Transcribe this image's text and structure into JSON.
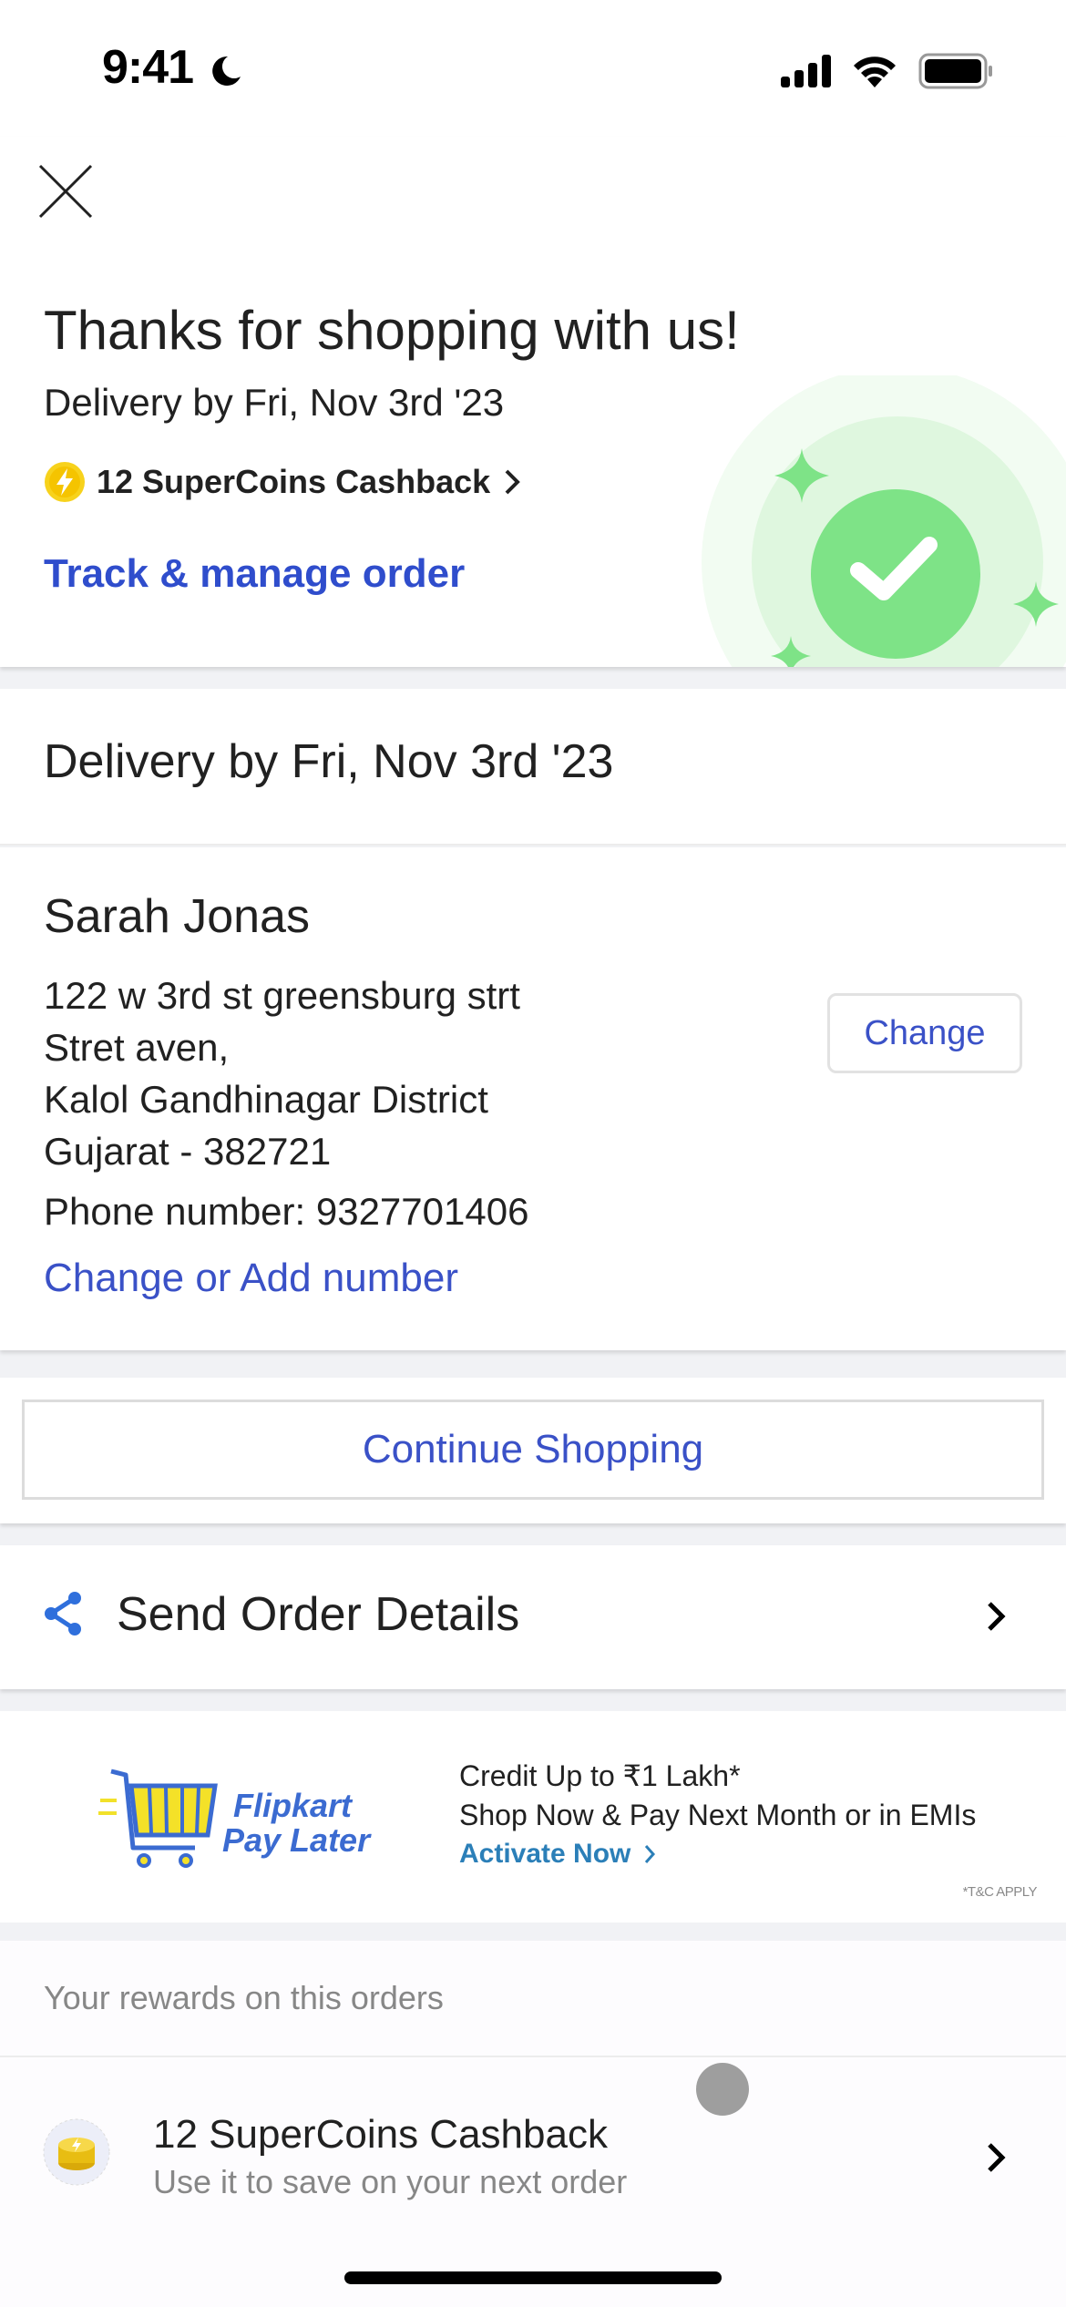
{
  "status_bar": {
    "time": "9:41",
    "focus_icon": "moon-icon",
    "signal_icon": "cellular-signal-icon",
    "wifi_icon": "wifi-icon",
    "battery_icon": "battery-icon"
  },
  "header": {
    "close_icon": "close-icon",
    "title": "Thanks for shopping with us!",
    "delivery": "Delivery by Fri, Nov 3rd '23",
    "supercoins": {
      "icon": "supercoin-lightning-icon",
      "label": "12 SuperCoins Cashback",
      "chevron": "chevron-right-icon"
    },
    "track_link": "Track & manage order",
    "illustration": "success-checkmark-icon"
  },
  "delivery_section": {
    "text": "Delivery by Fri, Nov 3rd '23"
  },
  "address": {
    "name": "Sarah Jonas",
    "lines": [
      "122 w 3rd st greensburg strt",
      "Stret aven,",
      "Kalol Gandhinagar District",
      "Gujarat - 382721"
    ],
    "phone": "Phone number: 9327701406",
    "change_number_link": "Change or Add number",
    "change_button": "Change"
  },
  "continue_shopping": {
    "label": "Continue Shopping"
  },
  "send_order": {
    "icon": "share-icon",
    "label": "Send Order Details",
    "chevron": "chevron-right-icon"
  },
  "pay_later_banner": {
    "logo_line1": "Flipkart",
    "logo_line2": "Pay Later",
    "headline": "Credit Up to ₹1 Lakh*",
    "subline": "Shop Now & Pay Next Month or in EMIs",
    "cta": "Activate Now",
    "disclaimer": "*T&C APPLY"
  },
  "rewards": {
    "header": "Your rewards on this orders",
    "items": [
      {
        "icon": "supercoin-stack-icon",
        "title": "12 SuperCoins Cashback",
        "subtitle": "Use it to save on your next order"
      }
    ]
  },
  "colors": {
    "link_blue": "#2f4dcc",
    "success_green": "#7ee387",
    "coin_yellow": "#f7d21c",
    "activate_blue": "#2b7fb8",
    "background": "#f1f2f5"
  }
}
